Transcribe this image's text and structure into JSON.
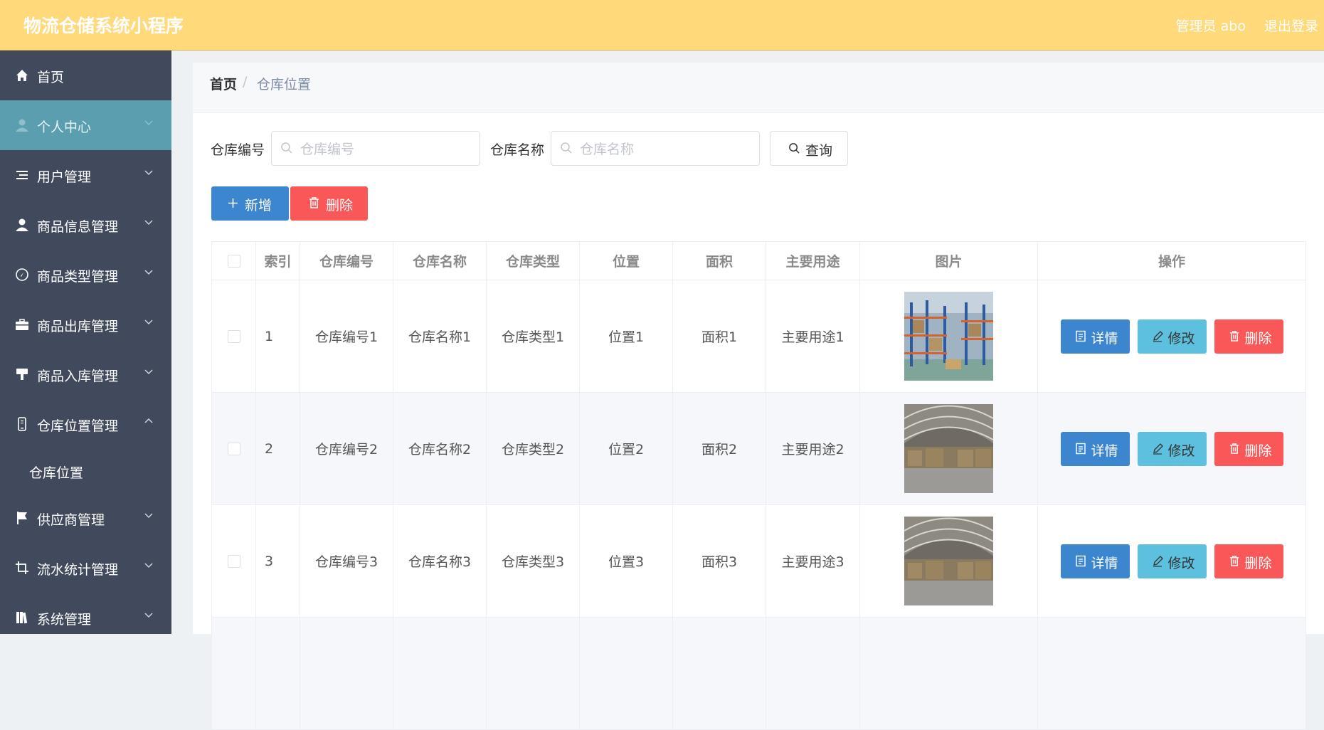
{
  "header": {
    "app_title": "物流仓储系统小程序",
    "user_label": "管理员 abo",
    "logout_label": "退出登录",
    "bg_color": "#ffd97a"
  },
  "sidebar": {
    "bg_color": "#404a5c",
    "active_color": "#5a9eb0",
    "items": [
      {
        "label": "首页",
        "icon": "home-icon",
        "expandable": false
      },
      {
        "label": "个人中心",
        "icon": "user-icon",
        "expandable": true,
        "active": true
      },
      {
        "label": "用户管理",
        "icon": "list-icon",
        "expandable": true
      },
      {
        "label": "商品信息管理",
        "icon": "user-icon",
        "expandable": true
      },
      {
        "label": "商品类型管理",
        "icon": "compass-icon",
        "expandable": true
      },
      {
        "label": "商品出库管理",
        "icon": "briefcase-icon",
        "expandable": true
      },
      {
        "label": "商品入库管理",
        "icon": "brush-icon",
        "expandable": true
      },
      {
        "label": "仓库位置管理",
        "icon": "phone-icon",
        "expandable": true,
        "expanded": true
      },
      {
        "label": "供应商管理",
        "icon": "flag-icon",
        "expandable": true
      },
      {
        "label": "流水统计管理",
        "icon": "crop-icon",
        "expandable": true
      },
      {
        "label": "系统管理",
        "icon": "book-icon",
        "expandable": true
      }
    ],
    "subitems": [
      {
        "label": "仓库位置",
        "parent": "仓库位置管理"
      }
    ]
  },
  "breadcrumb": {
    "home": "首页",
    "separator": "/",
    "current": "仓库位置"
  },
  "search": {
    "code_label": "仓库编号",
    "code_placeholder": "仓库编号",
    "code_value": "",
    "name_label": "仓库名称",
    "name_placeholder": "仓库名称",
    "name_value": "",
    "query_label": "查询"
  },
  "toolbar": {
    "add_label": "新增",
    "delete_label": "删除"
  },
  "table": {
    "headers": [
      "",
      "索引",
      "仓库编号",
      "仓库名称",
      "仓库类型",
      "位置",
      "面积",
      "主要用途",
      "图片",
      "操作"
    ],
    "rows": [
      {
        "index": "1",
        "code": "仓库编号1",
        "name": "仓库名称1",
        "type": "仓库类型1",
        "location": "位置1",
        "area": "面积1",
        "usage": "主要用途1",
        "image": "warehouse-racks-photo"
      },
      {
        "index": "2",
        "code": "仓库编号2",
        "name": "仓库名称2",
        "type": "仓库类型2",
        "location": "位置2",
        "area": "面积2",
        "usage": "主要用途2",
        "image": "warehouse-hall-photo"
      },
      {
        "index": "3",
        "code": "仓库编号3",
        "name": "仓库名称3",
        "type": "仓库类型3",
        "location": "位置3",
        "area": "面积3",
        "usage": "主要用途3",
        "image": "warehouse-hall-photo"
      }
    ],
    "actions": {
      "detail_label": "详情",
      "edit_label": "修改",
      "delete_label": "删除",
      "detail_color": "#3b86cf",
      "edit_color": "#5cc0de",
      "delete_color": "#fa5858"
    }
  }
}
